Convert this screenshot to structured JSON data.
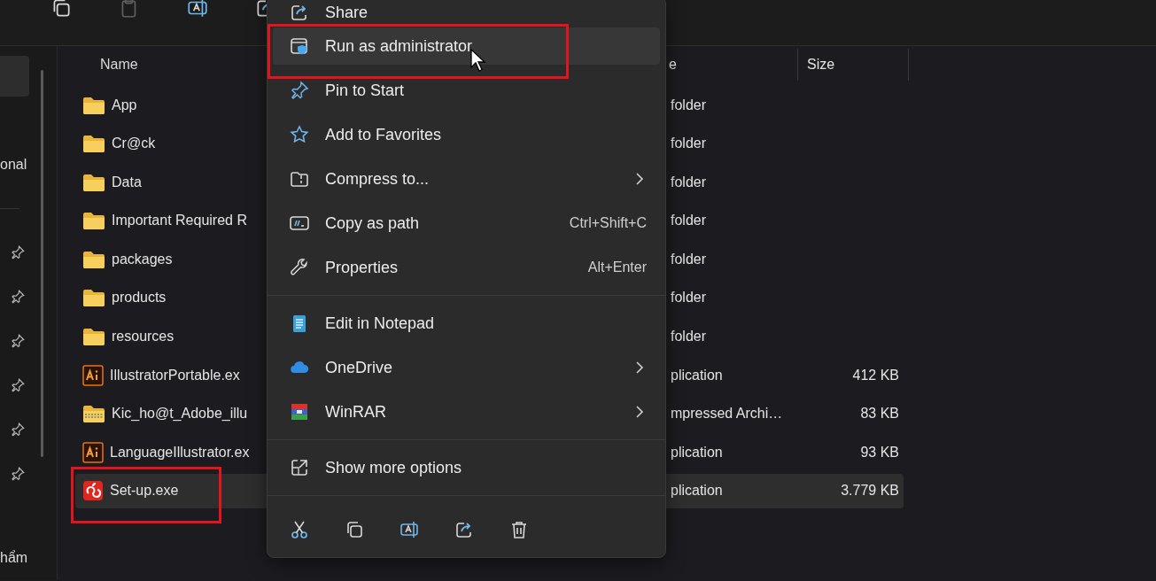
{
  "toolbar": {
    "buttons": [
      {
        "kind": "copy",
        "disabled": false
      },
      {
        "kind": "paste",
        "disabled": true
      },
      {
        "kind": "rename",
        "disabled": false
      },
      {
        "kind": "share",
        "disabled": false
      }
    ]
  },
  "sidebar": {
    "sections": [
      [
        {
          "selected": true,
          "pinned": false
        },
        {
          "label": "onal",
          "selected": false,
          "pinned": false
        }
      ],
      [
        {
          "selected": false,
          "pinned": true
        },
        {
          "selected": false,
          "pinned": true
        },
        {
          "selected": false,
          "pinned": true
        },
        {
          "selected": false,
          "pinned": true
        },
        {
          "selected": false,
          "pinned": true
        },
        {
          "selected": false,
          "pinned": true
        }
      ],
      [
        {
          "label": "hẩm",
          "selected": false,
          "pinned": false
        }
      ]
    ]
  },
  "file_list": {
    "columns": {
      "name": "Name",
      "column_2": "e",
      "size": "Size"
    },
    "rows": [
      {
        "kind": "folder",
        "name": "App",
        "column_2": "folder",
        "selected": false
      },
      {
        "kind": "folder",
        "name": "Cr@ck",
        "column_2": "folder",
        "selected": false
      },
      {
        "kind": "folder",
        "name": "Data",
        "column_2": "folder",
        "selected": false
      },
      {
        "kind": "folder",
        "name": "Important Required R",
        "column_2": "folder",
        "selected": false
      },
      {
        "kind": "folder",
        "name": "packages",
        "column_2": "folder",
        "selected": false
      },
      {
        "kind": "folder",
        "name": "products",
        "column_2": "folder",
        "selected": false
      },
      {
        "kind": "folder",
        "name": "resources",
        "column_2": "folder",
        "selected": false
      },
      {
        "kind": "illustrator",
        "name": "IllustratorPortable.ex",
        "column_2": "plication",
        "size": "412 KB",
        "selected": false
      },
      {
        "kind": "archive",
        "name": "Kic_ho@t_Adobe_illu",
        "column_2": "mpressed Archi…",
        "size": "83 KB",
        "selected": false
      },
      {
        "kind": "illustrator",
        "name": "LanguageIllustrator.ex",
        "column_2": "plication",
        "size": "93 KB",
        "selected": false
      },
      {
        "kind": "setup",
        "name": "Set-up.exe",
        "column_2": "plication",
        "size": "3.779 KB",
        "selected": true
      }
    ]
  },
  "context_menu": {
    "groups": [
      [
        {
          "label": "Share",
          "selected": false,
          "submenu": false
        },
        {
          "label": "Run as administrator",
          "selected": true,
          "submenu": false
        },
        {
          "label": "Pin to Start",
          "selected": false,
          "submenu": false
        },
        {
          "label": "Add to Favorites",
          "selected": false,
          "submenu": false
        },
        {
          "label": "Compress to...",
          "selected": false,
          "submenu": true
        },
        {
          "label": "Copy as path",
          "shortcut": "Ctrl+Shift+C",
          "selected": false,
          "submenu": false
        },
        {
          "label": "Properties",
          "shortcut": "Alt+Enter",
          "selected": false,
          "submenu": false
        }
      ],
      [
        {
          "label": "Edit in Notepad",
          "selected": false,
          "submenu": false
        },
        {
          "label": "OneDrive",
          "selected": false,
          "submenu": true
        },
        {
          "label": "WinRAR",
          "selected": false,
          "submenu": true
        }
      ],
      [
        {
          "label": "Show more options",
          "selected": false,
          "submenu": false
        }
      ]
    ]
  }
}
